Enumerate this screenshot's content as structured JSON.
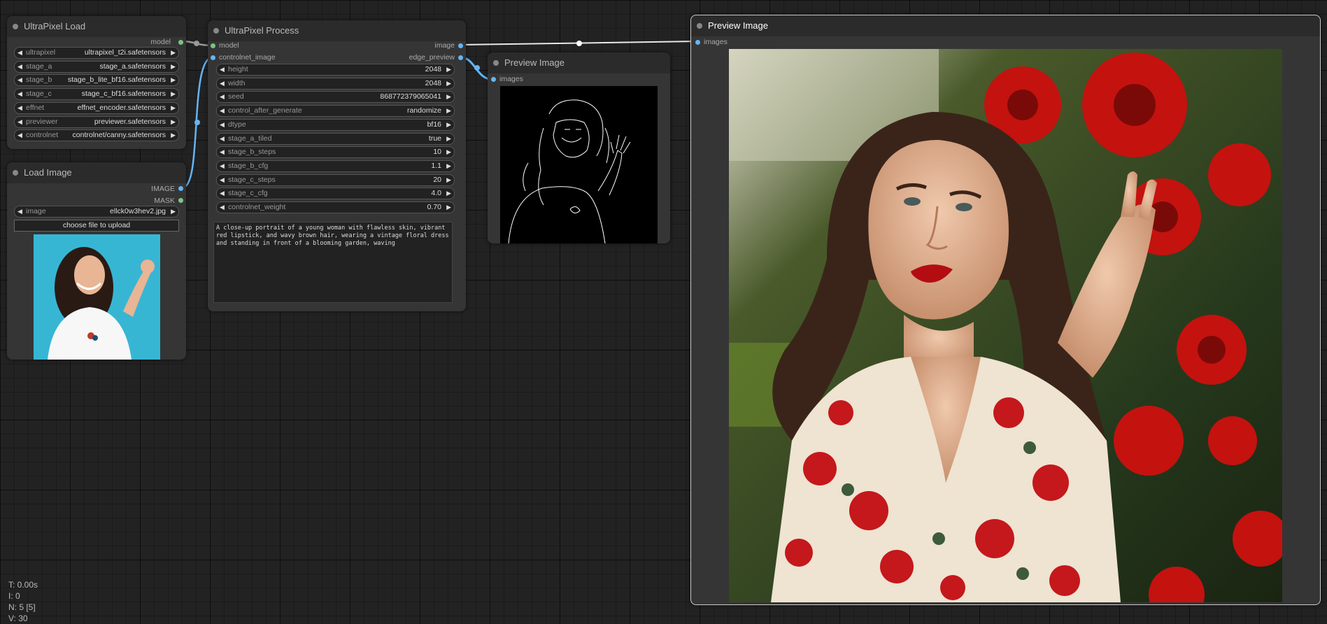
{
  "nodes": {
    "ultrapixel_load": {
      "title": "UltraPixel Load",
      "output": "model",
      "widgets": [
        {
          "name": "ultrapixel",
          "value": "ultrapixel_t2i.safetensors"
        },
        {
          "name": "stage_a",
          "value": "stage_a.safetensors"
        },
        {
          "name": "stage_b",
          "value": "stage_b_lite_bf16.safetensors"
        },
        {
          "name": "stage_c",
          "value": "stage_c_bf16.safetensors"
        },
        {
          "name": "effnet",
          "value": "effnet_encoder.safetensors"
        },
        {
          "name": "previewer",
          "value": "previewer.safetensors"
        },
        {
          "name": "controlnet",
          "value": "controlnet/canny.safetensors"
        }
      ]
    },
    "load_image": {
      "title": "Load Image",
      "outputs": [
        "IMAGE",
        "MASK"
      ],
      "widget": {
        "name": "image",
        "value": "ellck0w3hev2.jpg"
      },
      "upload_label": "choose file to upload"
    },
    "ultrapixel_process": {
      "title": "UltraPixel Process",
      "inputs": [
        "model",
        "controlnet_image"
      ],
      "outputs": [
        "image",
        "edge_preview"
      ],
      "widgets": [
        {
          "name": "height",
          "value": "2048"
        },
        {
          "name": "width",
          "value": "2048"
        },
        {
          "name": "seed",
          "value": "868772379065041"
        },
        {
          "name": "control_after_generate",
          "value": "randomize"
        },
        {
          "name": "dtype",
          "value": "bf16"
        },
        {
          "name": "stage_a_tiled",
          "value": "true"
        },
        {
          "name": "stage_b_steps",
          "value": "10"
        },
        {
          "name": "stage_b_cfg",
          "value": "1.1"
        },
        {
          "name": "stage_c_steps",
          "value": "20"
        },
        {
          "name": "stage_c_cfg",
          "value": "4.0"
        },
        {
          "name": "controlnet_weight",
          "value": "0.70"
        }
      ],
      "prompt": "A close-up portrait of a young woman with flawless skin, vibrant red lipstick, and wavy brown hair, wearing a vintage floral dress and standing in front of a blooming garden, waving"
    },
    "preview_small": {
      "title": "Preview Image",
      "input": "images"
    },
    "preview_large": {
      "title": "Preview Image",
      "input": "images"
    }
  },
  "stats": {
    "t": "T: 0.00s",
    "i": "I: 0",
    "n": "N: 5 [5]",
    "v": "V: 30"
  },
  "colors": {
    "model_slot": "#7ec37e",
    "image_slot": "#64b5f6",
    "mask_slot": "#81c784",
    "link_image": "#64b5f6",
    "link_model": "#aaaaaa"
  }
}
